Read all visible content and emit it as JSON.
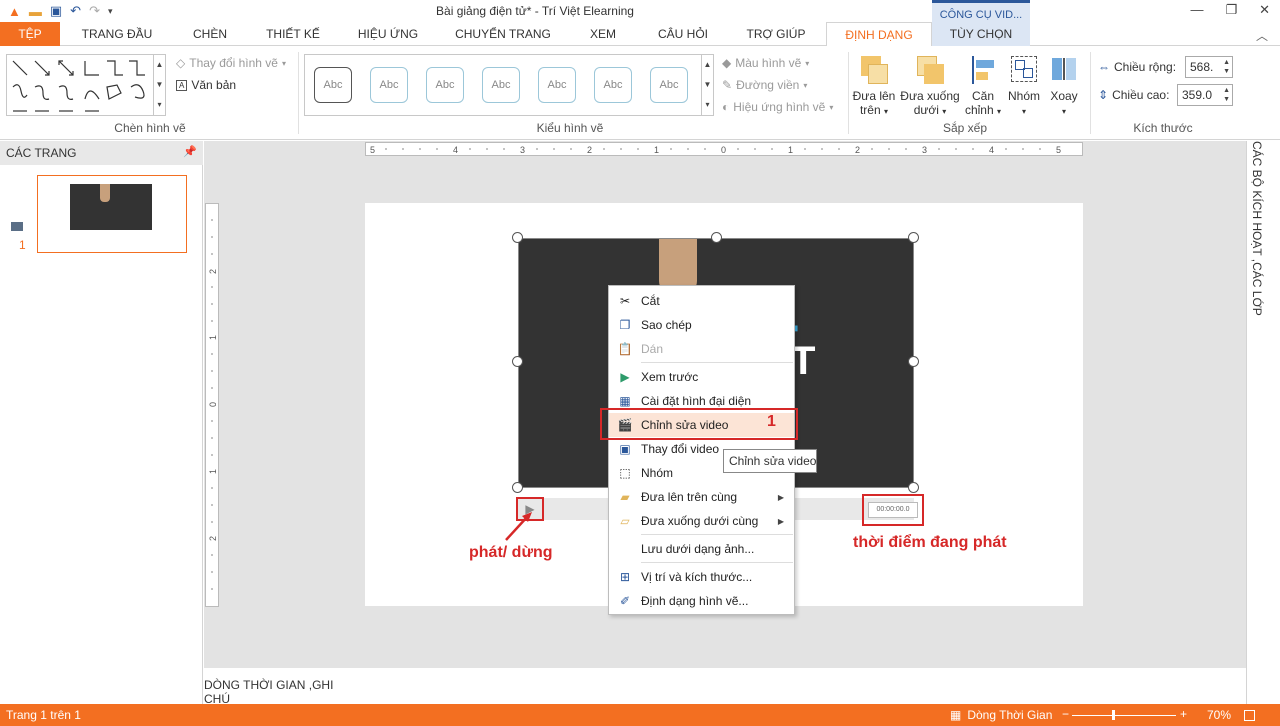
{
  "app": {
    "title": "Bài giảng điện tử* - Trí Việt Elearning",
    "context_tools": "CÔNG CỤ VID..."
  },
  "tabs": [
    {
      "label": "TỆP"
    },
    {
      "label": "TRANG ĐẦU"
    },
    {
      "label": "CHÈN"
    },
    {
      "label": "THIẾT KẾ"
    },
    {
      "label": "HIỆU ỨNG"
    },
    {
      "label": "CHUYỂN TRANG"
    },
    {
      "label": "XEM"
    },
    {
      "label": "CÂU HỎI"
    },
    {
      "label": "TRỢ GIÚP"
    },
    {
      "label": "ĐỊNH DẠNG"
    },
    {
      "label": "TÙY CHỌN"
    }
  ],
  "ribbon": {
    "insert_shapes": {
      "change_shape": "Thay đổi hình vẽ",
      "text": "Văn bản",
      "label": "Chèn hình vẽ"
    },
    "shape_styles": {
      "sample": "Abc",
      "fill": "Màu hình vẽ",
      "outline": "Đường viền",
      "effects": "Hiệu ứng hình vẽ",
      "label": "Kiểu hình vẽ"
    },
    "arrange": {
      "bring_forward_1": "Đưa lên",
      "bring_forward_2": "trên",
      "send_backward_1": "Đưa xuống",
      "send_backward_2": "dưới",
      "align_1": "Căn",
      "align_2": "chỉnh",
      "group": "Nhóm",
      "rotate": "Xoay",
      "label": "Sắp xếp"
    },
    "size": {
      "width_label": "Chiều rộng:",
      "width_value": "568.",
      "height_label": "Chiều cao:",
      "height_value": "359.0",
      "label": "Kích thước"
    }
  },
  "pages_panel": {
    "title": "CÁC TRANG",
    "slide_number": "1"
  },
  "right_panel": {
    "title": "CÁC BỘ KÍCH HOẠT ,CÁC LỚP"
  },
  "video": {
    "time": "00:00:00.0"
  },
  "context_menu": {
    "items": [
      {
        "label": "Cắt"
      },
      {
        "label": "Sao chép"
      },
      {
        "label": "Dán"
      },
      {
        "label": "Xem trước"
      },
      {
        "label": "Cài đặt hình đại diện"
      },
      {
        "label": "Chỉnh sửa video"
      },
      {
        "label": "Thay đổi video"
      },
      {
        "label": "Nhóm"
      },
      {
        "label": "Đưa lên trên cùng"
      },
      {
        "label": "Đưa xuống dưới cùng"
      },
      {
        "label": "Lưu dưới dạng ảnh..."
      },
      {
        "label": "Vị trí và kích thước..."
      },
      {
        "label": "Định dạng hình vẽ..."
      }
    ]
  },
  "tooltip": "Chỉnh sửa video",
  "annotations": {
    "step": "1",
    "play_pause": "phát/ dừng",
    "current_time": "thời điểm đang phát"
  },
  "timeline": {
    "tab_label": "DÒNG THỜI GIAN ,GHI CHÚ"
  },
  "status": {
    "page": "Trang 1 trên 1",
    "timeline": "Dòng Thời Gian",
    "zoom": "70%"
  },
  "colors": {
    "accent": "#f36f21",
    "annotation": "#d62828",
    "highlight": "#fce4d6"
  }
}
